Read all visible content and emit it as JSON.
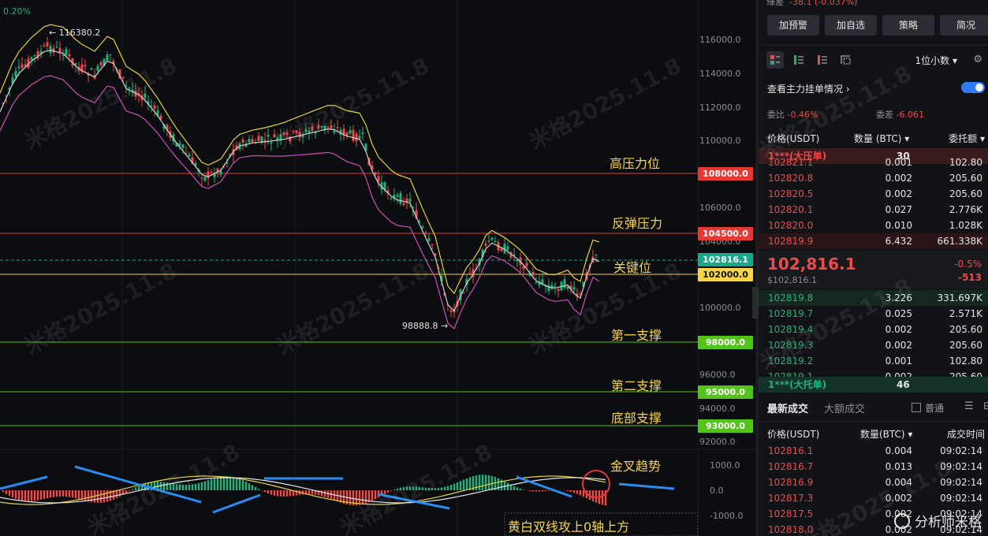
{
  "chart": {
    "pct_label": "0.20%",
    "y_axis_labels": [
      "116000.0",
      "114000.0",
      "112000.0",
      "110000.0",
      "106000.0",
      "104000.0",
      "100000.0",
      "96000.0",
      "94000.0",
      "92000.0"
    ],
    "macd_labels": [
      "1000.0",
      "0.0",
      "-1000.0"
    ],
    "levels": [
      {
        "id": "lvl-108000",
        "price_tag": "108000.0",
        "text": "高压力位",
        "color": "#e53935",
        "tag_bg": "#e53935"
      },
      {
        "id": "lvl-104500",
        "price_tag": "104500.0",
        "text": "反弹压力",
        "color": "#e53935",
        "tag_bg": "#e53935"
      },
      {
        "id": "lvl-102000",
        "price_tag": "102000.0",
        "text": "关键位",
        "color": "#f7d54a",
        "tag_bg": "#f7d54a"
      },
      {
        "id": "lvl-98000",
        "price_tag": "98000.0",
        "text": "第一支撑",
        "color": "#52c41a",
        "tag_bg": "#52c41a"
      },
      {
        "id": "lvl-95000",
        "price_tag": "95000.0",
        "text": "第二支撑",
        "color": "#52c41a",
        "tag_bg": "#52c41a"
      },
      {
        "id": "lvl-93000",
        "price_tag": "93000.0",
        "text": "底部支撑",
        "color": "#52c41a",
        "tag_bg": "#52c41a"
      }
    ],
    "current_price_tag": "102816.1",
    "high_annotation": "← 116380.2",
    "low_annotation": "98888.8 →",
    "macd_note": "金叉趋势",
    "macd_note2": "黄白双线攻上0轴上方",
    "watermark": "米格2025.11.8"
  },
  "panel": {
    "top_cut": {
      "label": "綠差",
      "value": "-38.1 (-0.037%)"
    },
    "buttons": [
      "加预警",
      "加自选",
      "策略",
      "简况"
    ],
    "decimal_select": "1位小数 ▾",
    "settings_icon": "gear-icon",
    "toggle_label": "查看主力挂单情况 ›",
    "ratio": {
      "label1": "委比",
      "value1": "-0.46%",
      "label2": "委差",
      "value2": "-6.061"
    },
    "ob_header": {
      "price": "价格(USDT)",
      "qty": "数量 (BTC) ▾",
      "total": "委托额 ▾"
    },
    "big_sell": {
      "label": "1***(大压单)",
      "qty": "30"
    },
    "asks": [
      {
        "p": "102821.1",
        "q": "0.001",
        "t": "102.80"
      },
      {
        "p": "102820.8",
        "q": "0.002",
        "t": "205.60"
      },
      {
        "p": "102820.5",
        "q": "0.002",
        "t": "205.60"
      },
      {
        "p": "102820.1",
        "q": "0.027",
        "t": "2.776K"
      },
      {
        "p": "102820.0",
        "q": "0.010",
        "t": "1.028K"
      },
      {
        "p": "102819.9",
        "q": "6.432",
        "t": "661.338K"
      }
    ],
    "mid": {
      "price": "102,816.1",
      "sub": "$102,816.1",
      "chg": "-0.5%",
      "chg2": "-513"
    },
    "bids": [
      {
        "p": "102819.8",
        "q": "3.226",
        "t": "331.697K"
      },
      {
        "p": "102819.7",
        "q": "0.025",
        "t": "2.571K"
      },
      {
        "p": "102819.4",
        "q": "0.002",
        "t": "205.60"
      },
      {
        "p": "102819.3",
        "q": "0.002",
        "t": "205.60"
      },
      {
        "p": "102819.2",
        "q": "0.001",
        "t": "102.80"
      },
      {
        "p": "102819.1",
        "q": "0.002",
        "t": "205.60"
      }
    ],
    "big_buy": {
      "label": "1***(大托单)",
      "qty": "46"
    },
    "trades_tabs": {
      "latest": "最新成交",
      "big": "大额成交",
      "normal": "普通"
    },
    "trades_header": {
      "price": "价格(USDT)",
      "qty": "数量(BTC) ▾",
      "time": "成交时间"
    },
    "trades": [
      {
        "p": "102816.1",
        "q": "0.004",
        "t": "09:02:14"
      },
      {
        "p": "102816.7",
        "q": "0.013",
        "t": "09:02:14"
      },
      {
        "p": "102816.9",
        "q": "0.004",
        "t": "09:02:14"
      },
      {
        "p": "102817.3",
        "q": "0.002",
        "t": "09:02:14"
      },
      {
        "p": "102817.5",
        "q": "0.002",
        "t": "09:02:14"
      },
      {
        "p": "102818.0",
        "q": "0.002",
        "t": "09:02:14"
      }
    ],
    "brand": "分析师米格"
  }
}
